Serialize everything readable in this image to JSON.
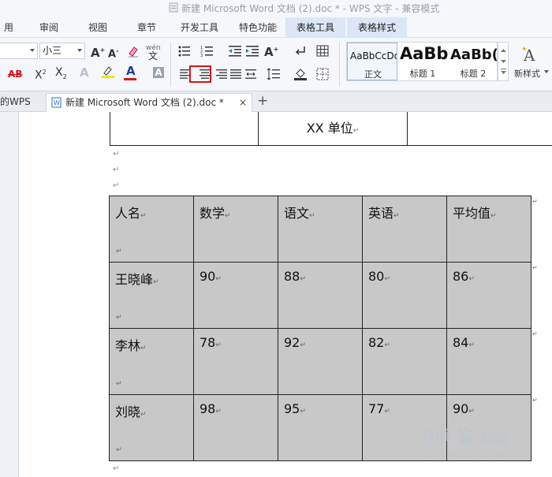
{
  "window": {
    "title": "新建 Microsoft Word 文档 (2).doc * - WPS 文字 - 兼容模式"
  },
  "menu": {
    "items": [
      "用",
      "审阅",
      "视图",
      "章节",
      "开发工具",
      "特色功能",
      "表格工具",
      "表格样式"
    ]
  },
  "toolbar": {
    "font_size": "小三",
    "style_samples": [
      "AaBbCcDd",
      "AaBb",
      "AaBb("
    ],
    "style_names": [
      "正文",
      "标题 1",
      "标题 2"
    ],
    "new_style_label": "新样式",
    "text_glyphs": {
      "grow_font": "A",
      "shrink_font": "A",
      "strikethrough": "AB",
      "superscript": "X",
      "subscript": "X",
      "text_effect": "A",
      "font_color": "A",
      "char_shading": "A",
      "new_style_icon": "A",
      "phonetic": "wén"
    },
    "accent_colors": {
      "highlight": "#f3e600",
      "font_color_bar": "#d9141b",
      "selected_box": "#d9141b",
      "context_tab": "#dbe6f6"
    }
  },
  "tabs": {
    "home": "的WPS",
    "document": "新建 Microsoft Word 文档 (2).doc *",
    "close_symbol": "×",
    "add_symbol": "+"
  },
  "document": {
    "header_cell": "XX 单位",
    "paragraph_mark": "↵",
    "row_end_mark": "↵",
    "table": [
      [
        "人名",
        "数学",
        "语文",
        "英语",
        "平均值"
      ],
      [
        "王晓峰",
        "90",
        "88",
        "80",
        "86"
      ],
      [
        "李林",
        "78",
        "92",
        "82",
        "84"
      ],
      [
        "刘晓",
        "98",
        "95",
        "77",
        "90"
      ]
    ]
  },
  "watermark": {
    "brand": "Bai",
    "brand_tail": "经验",
    "url": "jingyan.baidu.com"
  }
}
